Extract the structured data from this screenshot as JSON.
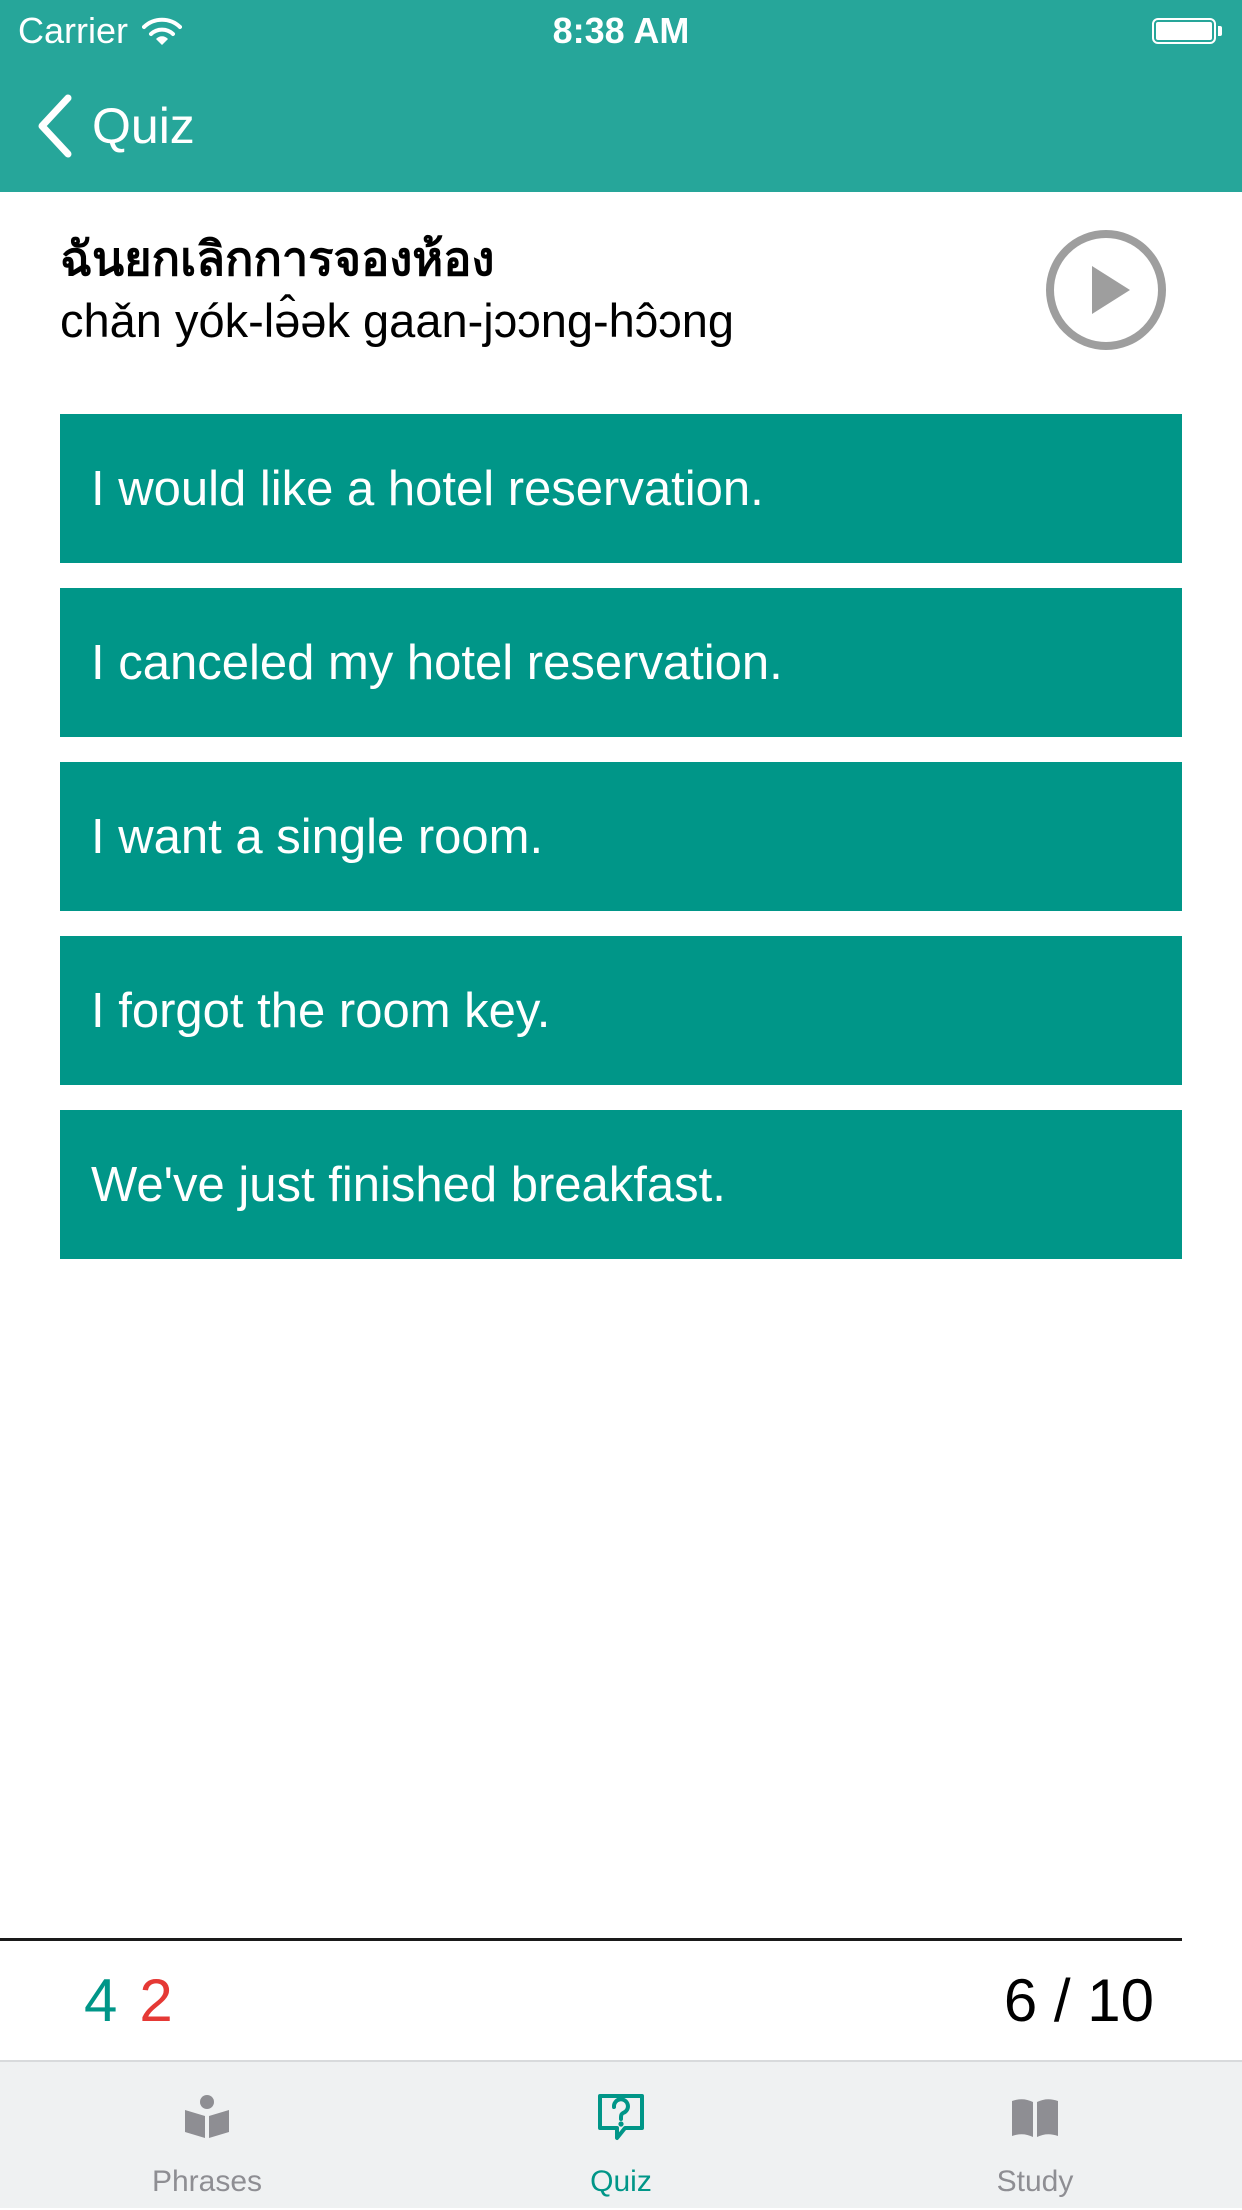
{
  "status_bar": {
    "carrier": "Carrier",
    "time": "8:38 AM",
    "icons": [
      "wifi-icon",
      "battery-icon"
    ]
  },
  "nav": {
    "back_label": "Quiz",
    "back_icon": "chevron-left-icon"
  },
  "prompt": {
    "thai": "ฉันยกเลิกการจองห้อง",
    "transliteration": "chǎn yók-lə̂ək gaan-jɔɔng-hɔ̂ɔng",
    "audio_icon": "play-circle-icon"
  },
  "answers": [
    "I would like a hotel reservation.",
    "I canceled my hotel reservation.",
    "I want a single room.",
    "I forgot the room key.",
    "We've just finished breakfast."
  ],
  "score": {
    "correct": "4",
    "incorrect": "2",
    "progress": "6 / 10"
  },
  "tabs": [
    {
      "label": "Phrases",
      "icon": "book-reader-icon",
      "active": false
    },
    {
      "label": "Quiz",
      "icon": "question-bubble-icon",
      "active": true
    },
    {
      "label": "Study",
      "icon": "open-book-icon",
      "active": false
    }
  ],
  "colors": {
    "header": "#26a69a",
    "answer_bg": "#009688",
    "correct": "#009688",
    "incorrect": "#e53935",
    "tab_active": "#009688",
    "tab_inactive": "#8e8e93",
    "play_icon": "#9e9e9e"
  }
}
